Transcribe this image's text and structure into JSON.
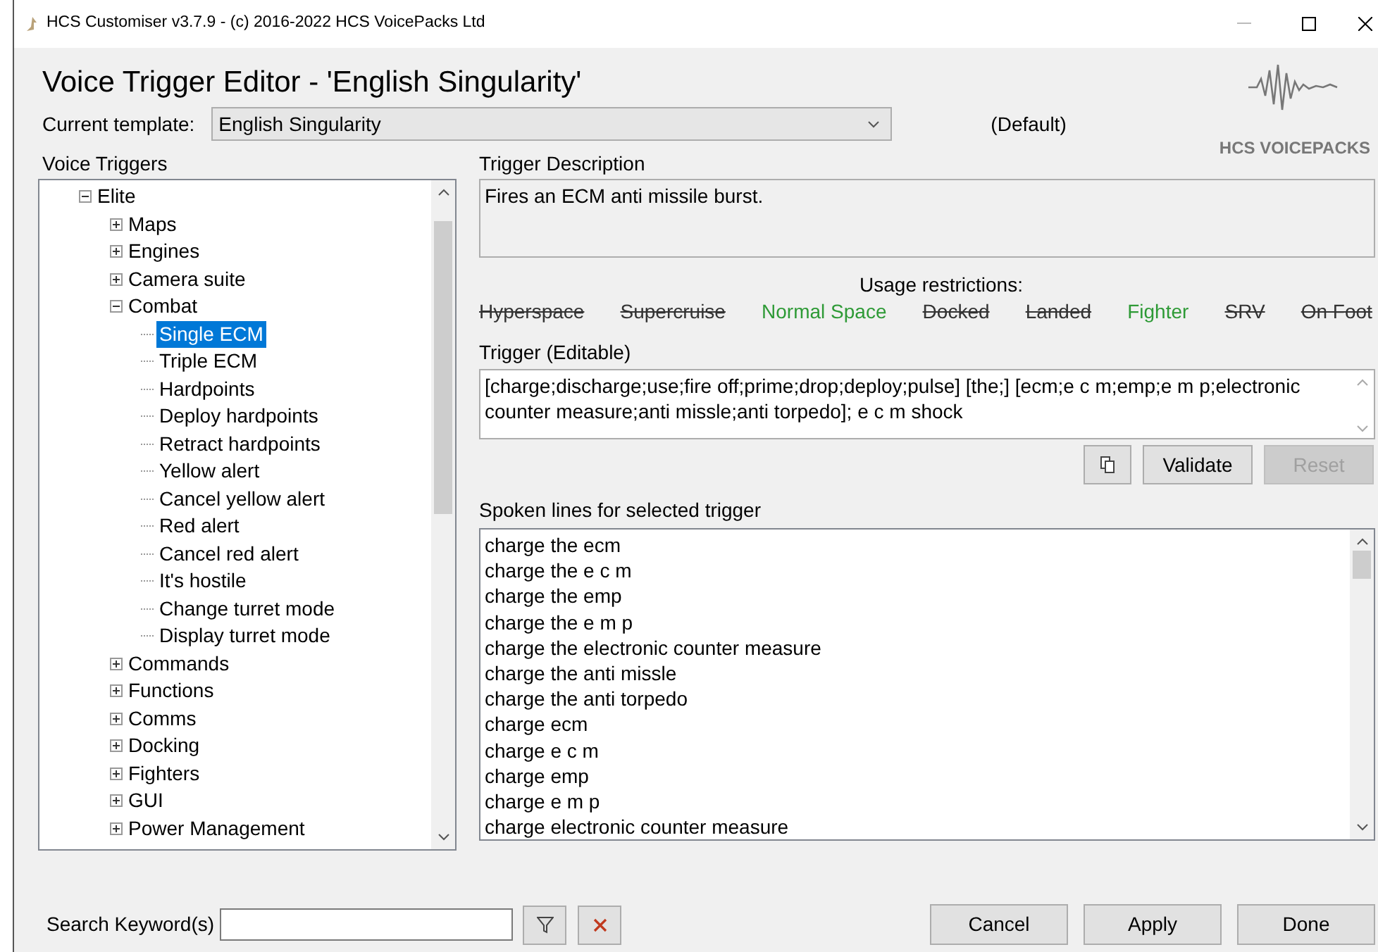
{
  "window": {
    "title": "HCS Customiser v3.7.9 - (c) 2016-2022 HCS VoicePacks Ltd"
  },
  "heading": "Voice Trigger Editor - 'English Singularity'",
  "template": {
    "label": "Current template:",
    "value": "English Singularity",
    "note": "(Default)"
  },
  "logo": {
    "text": "HCS VOICEPACKS"
  },
  "tree": {
    "label": "Voice Triggers",
    "items": [
      {
        "label": "Elite",
        "expanded": true,
        "selected": false,
        "children": [
          {
            "label": "Maps",
            "expanded": false,
            "selected": false
          },
          {
            "label": "Engines",
            "expanded": false,
            "selected": false
          },
          {
            "label": "Camera suite",
            "expanded": false,
            "selected": false
          },
          {
            "label": "Combat",
            "expanded": true,
            "selected": false,
            "children": [
              {
                "label": "Single ECM",
                "selected": true
              },
              {
                "label": "Triple ECM",
                "selected": false
              },
              {
                "label": "Hardpoints",
                "selected": false
              },
              {
                "label": "Deploy hardpoints",
                "selected": false
              },
              {
                "label": "Retract hardpoints",
                "selected": false
              },
              {
                "label": "Yellow alert",
                "selected": false
              },
              {
                "label": "Cancel yellow alert",
                "selected": false
              },
              {
                "label": "Red alert",
                "selected": false
              },
              {
                "label": "Cancel red alert",
                "selected": false
              },
              {
                "label": "It's hostile",
                "selected": false
              },
              {
                "label": "Change turret mode",
                "selected": false
              },
              {
                "label": "Display turret mode",
                "selected": false
              }
            ]
          },
          {
            "label": "Commands",
            "expanded": false,
            "selected": false
          },
          {
            "label": "Functions",
            "expanded": false,
            "selected": false
          },
          {
            "label": "Comms",
            "expanded": false,
            "selected": false
          },
          {
            "label": "Docking",
            "expanded": false,
            "selected": false
          },
          {
            "label": "Fighters",
            "expanded": false,
            "selected": false
          },
          {
            "label": "GUI",
            "expanded": false,
            "selected": false
          },
          {
            "label": "Power Management",
            "expanded": false,
            "selected": false
          }
        ]
      }
    ]
  },
  "description": {
    "label": "Trigger Description",
    "value": "Fires an ECM anti missile burst."
  },
  "usage": {
    "label": "Usage restrictions:",
    "items": [
      {
        "label": "Hyperspace",
        "allowed": false
      },
      {
        "label": "Supercruise",
        "allowed": false
      },
      {
        "label": "Normal Space",
        "allowed": true
      },
      {
        "label": "Docked",
        "allowed": false
      },
      {
        "label": "Landed",
        "allowed": false
      },
      {
        "label": "Fighter",
        "allowed": true
      },
      {
        "label": "SRV",
        "allowed": false
      },
      {
        "label": "On Foot",
        "allowed": false
      }
    ]
  },
  "trigger": {
    "label": "Trigger (Editable)",
    "value": "[charge;discharge;use;fire off;prime;drop;deploy;pulse] [the;] [ecm;e c m;emp;e m p;electronic counter measure;anti missle;anti torpedo]; e c m shock"
  },
  "trigger_buttons": [
    {
      "kind": "copy",
      "disabled": false
    },
    {
      "kind": "text",
      "label": "Validate",
      "disabled": false
    },
    {
      "kind": "text",
      "label": "Reset",
      "disabled": true
    }
  ],
  "spoken": {
    "label": "Spoken lines for selected trigger",
    "lines": [
      "charge the ecm",
      "charge the e c m",
      "charge the emp",
      "charge the e m p",
      "charge the electronic counter measure",
      "charge the anti missle",
      "charge the anti torpedo",
      "charge ecm",
      "charge e c m",
      "charge emp",
      "charge e m p",
      "charge electronic counter measure"
    ]
  },
  "search": {
    "label": "Search Keyword(s)"
  },
  "footer_buttons": [
    "Cancel",
    "Apply",
    "Done"
  ]
}
